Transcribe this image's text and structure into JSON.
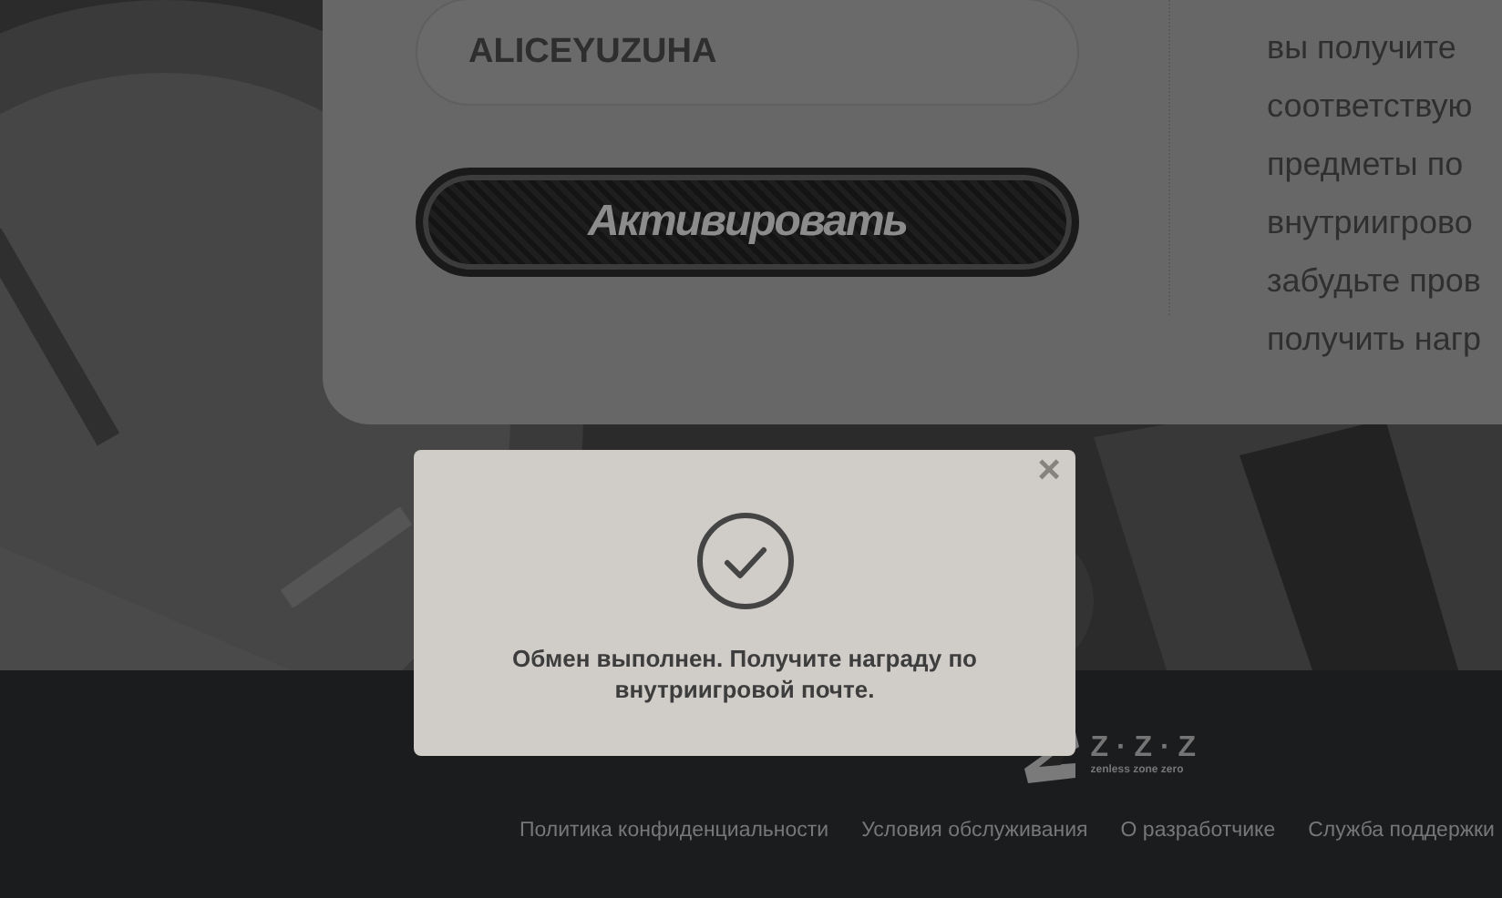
{
  "card": {
    "code_field": {
      "value": "ALICEYUZUHA"
    },
    "activate_button": "Активировать",
    "info_lines": [
      "вы получите",
      "соответствую",
      "предметы по",
      "внутриигрово",
      "забудьте пров",
      "получить нагр"
    ]
  },
  "dialog": {
    "close": "×",
    "message": "Обмен выполнен. Получите награду по внутриигровой почте."
  },
  "footer": {
    "logo": {
      "mark": "Z · Z · Z",
      "tagline": "zenless zone zero"
    },
    "links": [
      "Политика конфиденциальности",
      "Условия обслуживания",
      "О разработчике",
      "Служба поддержки"
    ]
  }
}
